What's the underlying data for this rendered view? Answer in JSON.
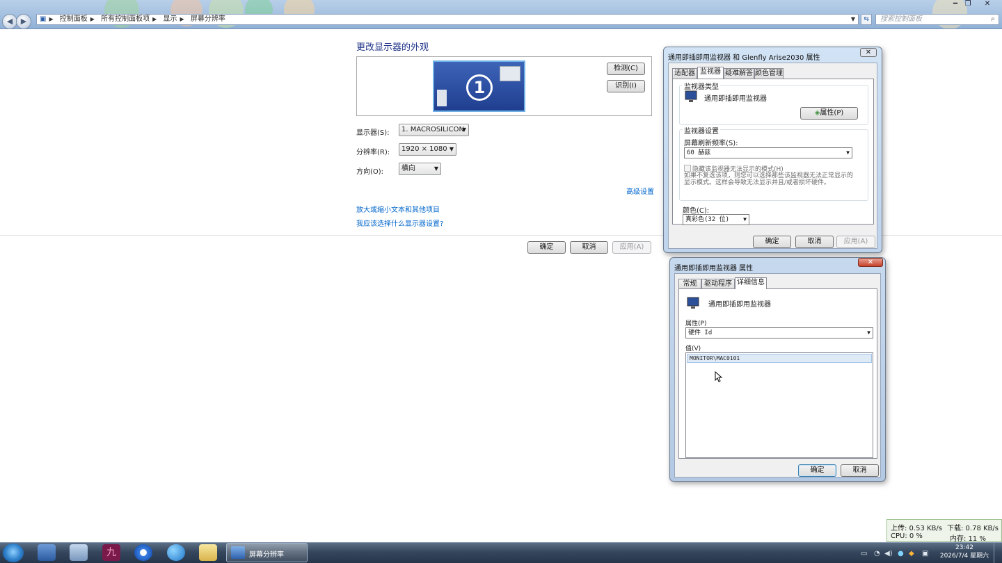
{
  "breadcrumb": [
    "控制面板",
    "所有控制面板项",
    "显示",
    "屏幕分辨率"
  ],
  "search_placeholder": "搜索控制面板",
  "main": {
    "title": "更改显示器的外观",
    "monitor_number": "1",
    "detect_button": "检测(C)",
    "identify_button": "识别(I)",
    "display_label": "显示器(S):",
    "display_value": "1. MACROSILICON",
    "resolution_label": "分辨率(R):",
    "resolution_value": "1920 × 1080",
    "orientation_label": "方向(O):",
    "orientation_value": "横向",
    "advanced_link": "高级设置",
    "link_text_size": "放大或缩小文本和其他项目",
    "link_which_settings": "我应该选择什么显示器设置?",
    "ok": "确定",
    "cancel": "取消",
    "apply": "应用(A)"
  },
  "dialog1": {
    "title": "通用即插即用监视器 和 Glenfly Arise2030 属性",
    "tabs": [
      "适配器",
      "监视器",
      "疑难解答",
      "颜色管理"
    ],
    "group_monitor_type": "监视器类型",
    "monitor_name": "通用即插即用监视器",
    "properties_button": "属性(P)",
    "group_monitor_settings": "监视器设置",
    "refresh_label": "屏幕刷新频率(S):",
    "refresh_value": "60 赫兹",
    "hide_modes_label": "隐藏该监视器无法显示的模式(H)",
    "hide_modes_note": "如果不复选该项，则您可以选择那些该监视器无法正常显示的显示模式。这样会导致无法显示并且/或者损坏硬件。",
    "colors_label": "颜色(C):",
    "colors_value": "真彩色(32 位)",
    "ok": "确定",
    "cancel": "取消",
    "apply": "应用(A)"
  },
  "dialog2": {
    "title": "通用即插即用监视器 属性",
    "tabs": [
      "常规",
      "驱动程序",
      "详细信息"
    ],
    "device_name": "通用即插即用监视器",
    "property_label": "属性(P)",
    "property_value": "硬件 Id",
    "value_label": "值(V)",
    "value_item": "MONITOR\\MAC0101",
    "ok": "确定",
    "cancel": "取消"
  },
  "netmon": {
    "upload": "上传: 0.53 KB/s",
    "download": "下载: 0.78 KB/s",
    "cpu": "CPU: 0 %",
    "memory": "内存: 11 %"
  },
  "taskbar": {
    "active_task": "屏幕分辨率",
    "time": "23:42",
    "date": "2026/7/4 星期六"
  }
}
